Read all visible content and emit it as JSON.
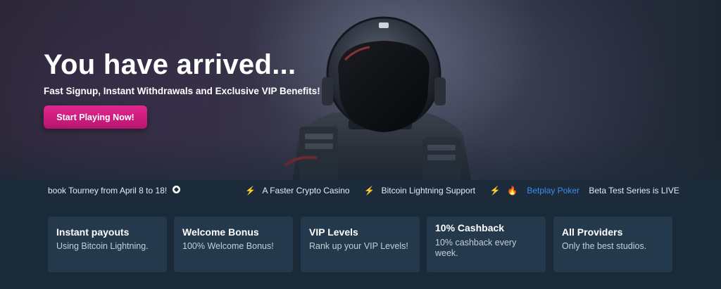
{
  "hero": {
    "title": "You have arrived...",
    "subtitle": "Fast Signup, Instant Withdrawals and Exclusive VIP Benefits!",
    "cta_label": "Start Playing Now!"
  },
  "ticker": {
    "item1": "book Tourney from April 8 to 18!",
    "item2": "A Faster Crypto Casino",
    "item3": "Bitcoin Lightning Support",
    "link": "Betplay Poker",
    "item4": "Beta Test Series is LIVE"
  },
  "features": [
    {
      "title": "Instant payouts",
      "desc": "Using Bitcoin Lightning."
    },
    {
      "title": "Welcome Bonus",
      "desc": "100% Welcome Bonus!"
    },
    {
      "title": "VIP Levels",
      "desc": "Rank up your VIP Levels!"
    },
    {
      "title": "10% Cashback",
      "desc": "10% cashback every week."
    },
    {
      "title": "All Providers",
      "desc": "Only the best studios."
    }
  ],
  "colors": {
    "accent": "#e1278f",
    "link": "#3d8bf2",
    "background": "#1b2a38",
    "card": "#24394b"
  }
}
